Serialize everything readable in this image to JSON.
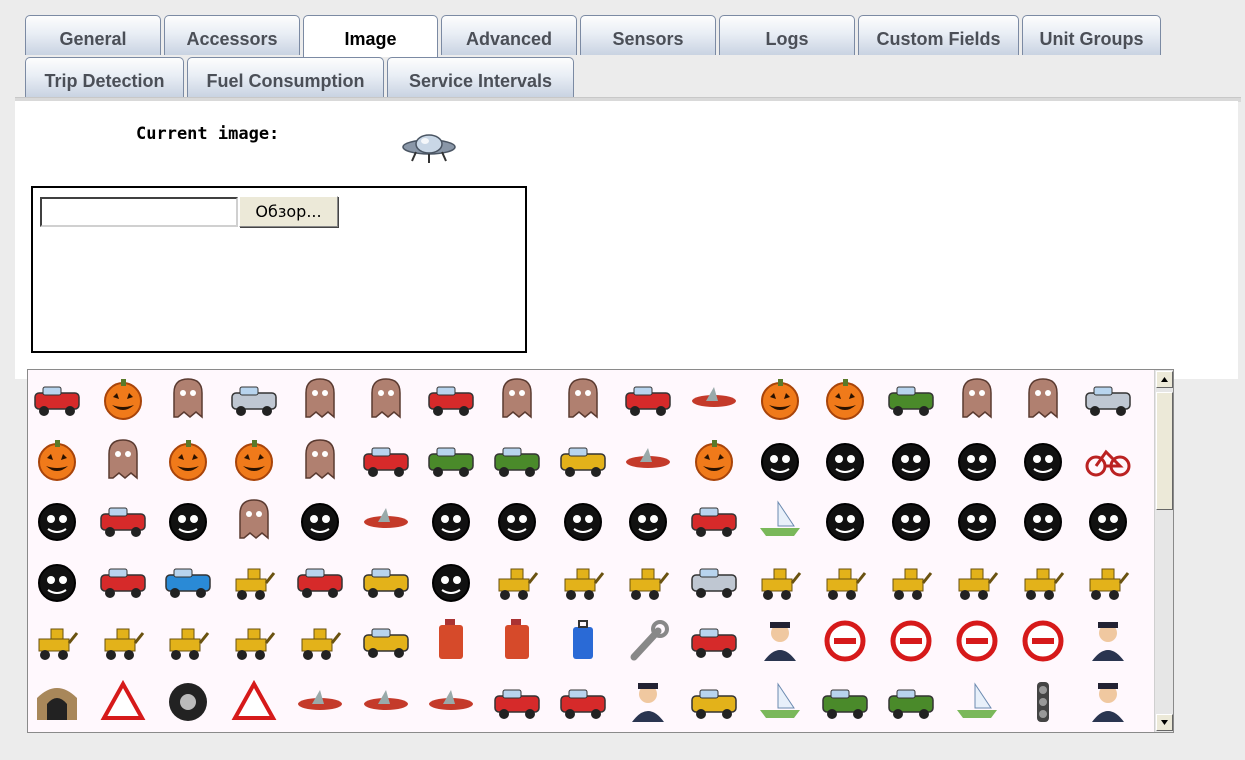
{
  "tabs": [
    {
      "label": "General",
      "active": false
    },
    {
      "label": "Accessors",
      "active": false
    },
    {
      "label": "Image",
      "active": true
    },
    {
      "label": "Advanced",
      "active": false
    },
    {
      "label": "Sensors",
      "active": false
    },
    {
      "label": "Logs",
      "active": false
    },
    {
      "label": "Custom Fields",
      "active": false
    },
    {
      "label": "Unit Groups",
      "active": false
    },
    {
      "label": "Trip Detection",
      "active": false
    },
    {
      "label": "Fuel Consumption",
      "active": false
    },
    {
      "label": "Service Intervals",
      "active": false
    }
  ],
  "current_image": {
    "label": "Current image:",
    "icon": "ufo-icon"
  },
  "upload": {
    "file_value": "",
    "browse_label": "Обзор..."
  },
  "icon_library": {
    "rows": [
      [
        "ambulance-icon",
        "jack-o-lantern-icon",
        "hooded-figure-icon",
        "silver-car-icon",
        "pink-ghost-icon",
        "grumpy-face-icon",
        "fire-truck-icon",
        "brown-monster-icon",
        "yellow-monster-icon",
        "red-truck-icon",
        "helicopter-icon",
        "pumpkin-icon",
        "pumpkin-grin-icon",
        "green-truck-icon",
        "ghost-icon",
        "green-zombie-icon",
        "police-car-icon"
      ],
      [
        "pumpkin-sad-icon",
        "paper-bag-icon",
        "pumpkin-swirl-icon",
        "pumpkin-wide-icon",
        "red-octopus-icon",
        "candle-icon",
        "tank-icon",
        "green-bus-icon",
        "yellow-truck-icon",
        "ufo-icon",
        "pumpkin-icon",
        "black-smiley-icon",
        "black-angry-teeth-icon",
        "black-grin-icon",
        "black-teeth-icon",
        "bomb-icon",
        "bicycle-icon"
      ],
      [
        "black-heart-icon",
        "cars-icon",
        "black-crying-icon",
        "skull-face-icon",
        "black-shout-icon",
        "satellite-icon",
        "black-flower-icon",
        "black-wink-icon",
        "black-mouth-icon",
        "black-money-icon",
        "motorcycle-icon",
        "sailboat-icon",
        "black-face-icon",
        "black-eyes-icon",
        "black-devil-icon",
        "striped-ball-icon",
        "black-sad-icon"
      ],
      [
        "bomb-face-icon",
        "red-car-icon",
        "blue-car-icon",
        "excavator-icon",
        "atv-icon",
        "pickup-icon",
        "black-truck-icon",
        "tractor-icon",
        "crane-excavator-icon",
        "dump-truck-icon",
        "tow-truck-icon",
        "bulldozer-icon",
        "loader-icon",
        "wheel-loader-icon",
        "backhoe-icon",
        "grader-icon",
        "digger-icon"
      ],
      [
        "dozer-icon",
        "road-roller-icon",
        "front-loader-icon",
        "mini-excavator-icon",
        "forklift-icon",
        "blue-pickup-icon",
        "gas-pump-icon",
        "fuel-can-icon",
        "luggage-icon",
        "wrench-icon",
        "scooter-icon",
        "mechanic-icon",
        "no-entry-icon",
        "no-overtaking-icon",
        "no-parking-icon",
        "no-vehicles-icon",
        "officer-icon"
      ],
      [
        "tunnel-icon",
        "yield-sign-icon",
        "tire-icon",
        "warning-sign-icon",
        "airliner-icon",
        "small-plane-icon",
        "airship-icon",
        "van-icon",
        "sports-car-icon",
        "officer-flag-icon",
        "taxi-icon",
        "speedboat-icon",
        "armored-car-icon",
        "jeep-icon",
        "boat-icon",
        "traffic-light-icon",
        "driver-icon"
      ],
      [
        "globe-icon",
        "fence-icon",
        "tire-icon",
        "road-sign-icon",
        "airliner-icon",
        "pole-icon",
        "lamp-icon",
        "saucer-icon",
        "fan-icon",
        "pin-icon",
        "house-icon",
        "wave-icon",
        "flag-icon",
        "cone-icon",
        "barrier-icon",
        "truck-icon",
        "person-icon"
      ]
    ]
  }
}
